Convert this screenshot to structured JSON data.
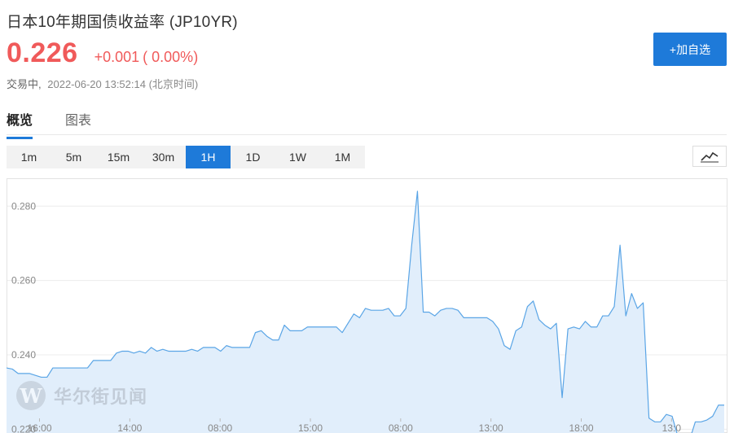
{
  "header": {
    "title": "日本10年期国债收益率 (JP10YR)",
    "price": "0.226",
    "change": "+0.001",
    "change_pct": "( 0.00%)",
    "status": "交易中,",
    "timestamp": "2022-06-20 13:52:14 (北京时间)",
    "add_button": "+加自选"
  },
  "tabs": [
    {
      "label": "概览",
      "active": true
    },
    {
      "label": "图表",
      "active": false
    }
  ],
  "intervals": [
    {
      "label": "1m",
      "active": false
    },
    {
      "label": "5m",
      "active": false
    },
    {
      "label": "15m",
      "active": false
    },
    {
      "label": "30m",
      "active": false
    },
    {
      "label": "1H",
      "active": true
    },
    {
      "label": "1D",
      "active": false
    },
    {
      "label": "1W",
      "active": false
    },
    {
      "label": "1M",
      "active": false
    }
  ],
  "watermark": {
    "logo": "W",
    "text": "华尔街见闻"
  },
  "colors": {
    "accent": "#1e7ad9",
    "up": "#f05a5a",
    "line": "#5aa5e6",
    "area": "#e1eefb"
  },
  "chart_data": {
    "type": "area",
    "ylim": [
      0.219,
      0.2875
    ],
    "yticks": [
      0.22,
      0.24,
      0.26,
      0.28
    ],
    "ytick_labels": [
      "0.220",
      "0.240",
      "0.260",
      "0.280"
    ],
    "x_ticks": [
      {
        "label": "16:00",
        "index": 5.7
      },
      {
        "label": "14:00",
        "index": 21.3
      },
      {
        "label": "08:00",
        "index": 36.9
      },
      {
        "label": "15:00",
        "index": 52.5
      },
      {
        "label": "08:00",
        "index": 68.1
      },
      {
        "label": "13:00",
        "index": 83.7
      },
      {
        "label": "18:00",
        "index": 99.3
      },
      {
        "label": "13:0",
        "index": 114.9
      }
    ],
    "grid": true,
    "values": [
      0.2365,
      0.2362,
      0.235,
      0.235,
      0.235,
      0.2345,
      0.234,
      0.234,
      0.2365,
      0.2365,
      0.2365,
      0.2365,
      0.2365,
      0.2365,
      0.2365,
      0.2385,
      0.2385,
      0.2385,
      0.2385,
      0.2405,
      0.241,
      0.241,
      0.2405,
      0.241,
      0.2405,
      0.242,
      0.241,
      0.2415,
      0.241,
      0.241,
      0.241,
      0.241,
      0.2415,
      0.241,
      0.242,
      0.242,
      0.242,
      0.241,
      0.2425,
      0.242,
      0.242,
      0.242,
      0.242,
      0.246,
      0.2465,
      0.245,
      0.244,
      0.244,
      0.248,
      0.2465,
      0.2465,
      0.2465,
      0.2475,
      0.2475,
      0.2475,
      0.2475,
      0.2475,
      0.2475,
      0.246,
      0.2485,
      0.251,
      0.25,
      0.2525,
      0.252,
      0.252,
      0.252,
      0.2525,
      0.2505,
      0.2505,
      0.2525,
      0.2695,
      0.284,
      0.2515,
      0.2515,
      0.2505,
      0.252,
      0.2525,
      0.2525,
      0.252,
      0.25,
      0.25,
      0.25,
      0.25,
      0.25,
      0.249,
      0.247,
      0.2425,
      0.2415,
      0.2465,
      0.2475,
      0.253,
      0.2545,
      0.2495,
      0.248,
      0.247,
      0.2485,
      0.2285,
      0.247,
      0.2475,
      0.247,
      0.249,
      0.2475,
      0.2475,
      0.2505,
      0.2505,
      0.253,
      0.2695,
      0.2505,
      0.2565,
      0.2525,
      0.254,
      0.223,
      0.222,
      0.222,
      0.224,
      0.2235,
      0.218,
      0.2165,
      0.217,
      0.222,
      0.222,
      0.2225,
      0.2235,
      0.2265,
      0.2265
    ]
  }
}
